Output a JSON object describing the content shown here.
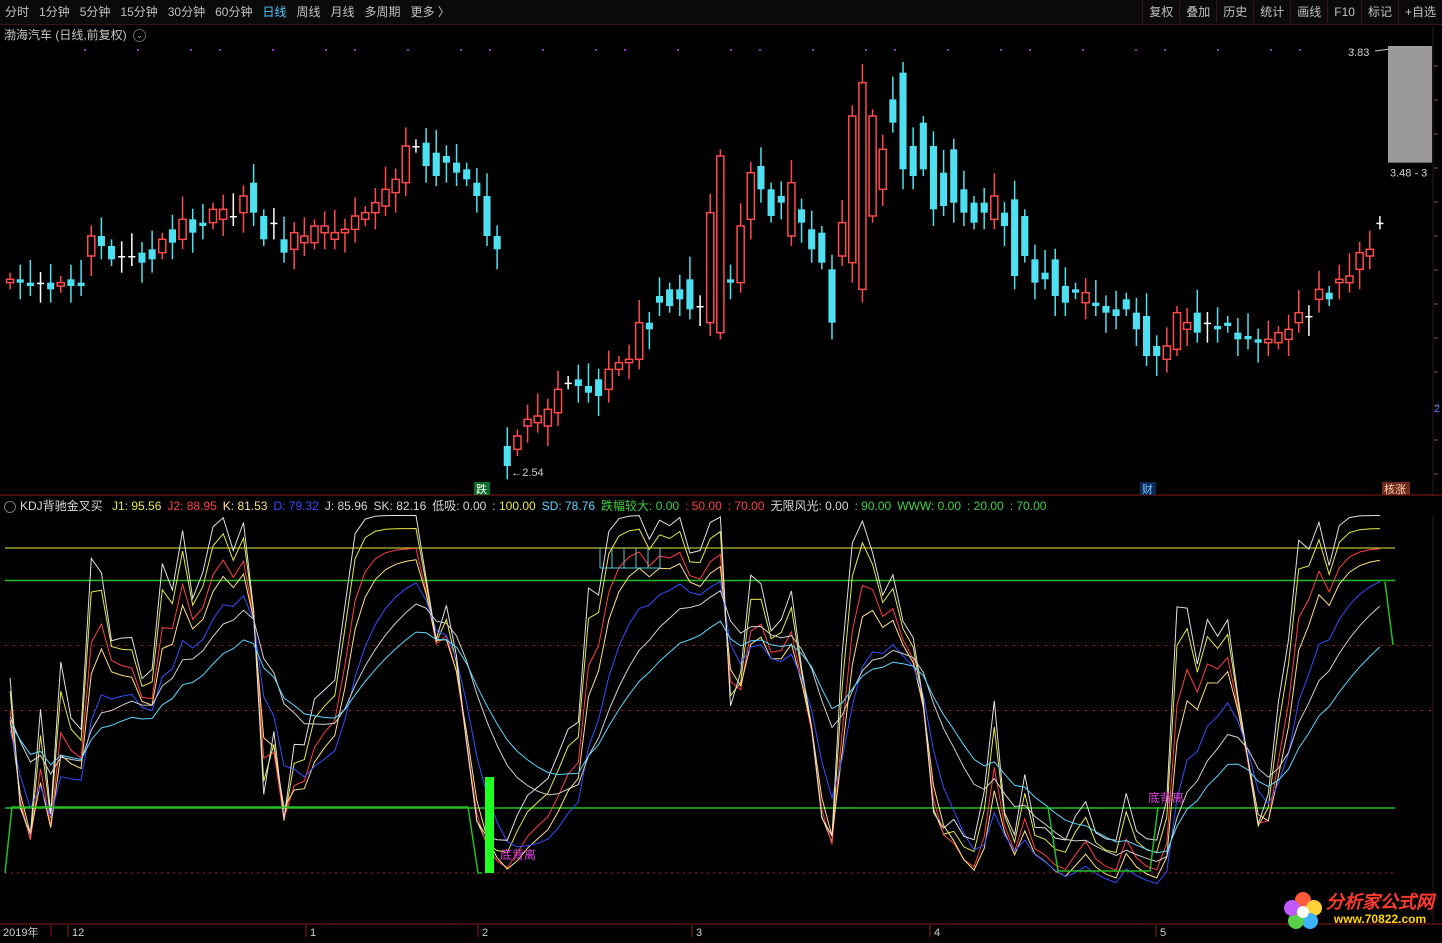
{
  "toolbar": {
    "periods": [
      {
        "label": "分时",
        "active": false
      },
      {
        "label": "1分钟",
        "active": false
      },
      {
        "label": "5分钟",
        "active": false
      },
      {
        "label": "15分钟",
        "active": false
      },
      {
        "label": "30分钟",
        "active": false
      },
      {
        "label": "60分钟",
        "active": false
      },
      {
        "label": "日线",
        "active": true
      },
      {
        "label": "周线",
        "active": false
      },
      {
        "label": "月线",
        "active": false
      },
      {
        "label": "多周期",
        "active": false
      },
      {
        "label": "更多 〉",
        "active": false
      }
    ],
    "tools": [
      "复权",
      "叠加",
      "历史",
      "统计",
      "画线",
      "F10",
      "标记",
      "+自选"
    ]
  },
  "stock": {
    "title": "渤海汽车 (日线,前复权)"
  },
  "price_axis": {
    "high_label": "3.83",
    "last_label": "3.48 - 3",
    "edge_label": "2"
  },
  "price_marks": {
    "low_label": "2.54"
  },
  "event_tags": [
    {
      "text": "跌",
      "color": "#ffffff",
      "bg": "#0f6b2a"
    },
    {
      "text": "财",
      "color": "#7fc8ff",
      "bg": "#0a2a55"
    },
    {
      "text": "核涨",
      "color": "#ffd0b0",
      "bg": "#6b2a1a"
    }
  ],
  "indicator": {
    "name": "KDJ背驰金叉买",
    "items": [
      {
        "text": "J1: 95.56",
        "color": "#e8e84a"
      },
      {
        "text": "J2: 88.95",
        "color": "#ff4040"
      },
      {
        "text": "K: 81.53",
        "color": "#ffe080"
      },
      {
        "text": "D: 79.32",
        "color": "#3050ff"
      },
      {
        "text": "J: 85.96",
        "color": "#d8d8d8"
      },
      {
        "text": "SK: 82.16",
        "color": "#d8d8d8"
      },
      {
        "text": "低吸: 0.00",
        "color": "#d8d8d8"
      },
      {
        "text": ": 100.00",
        "color": "#e8e84a"
      },
      {
        "text": "SD: 78.76",
        "color": "#5ad8ff"
      },
      {
        "text": "跌幅较大: 0.00",
        "color": "#40d040"
      },
      {
        "text": ": 50.00",
        "color": "#ff4040"
      },
      {
        "text": ": 70.00",
        "color": "#ff4040"
      },
      {
        "text": "无限风光: 0.00",
        "color": "#d8d8d8"
      },
      {
        "text": ": 90.00",
        "color": "#40d040"
      },
      {
        "text": "WWW: 0.00",
        "color": "#40d040"
      },
      {
        "text": ": 20.00",
        "color": "#40d040"
      },
      {
        "text": ": 70.00",
        "color": "#40d040"
      }
    ],
    "annotations": [
      "底背离",
      "底背离"
    ]
  },
  "date_axis": [
    "2019年",
    "12",
    "1",
    "2",
    "3",
    "4",
    "5"
  ],
  "watermark": {
    "text": "分析家公式网",
    "url": "www.70822.com"
  },
  "colors": {
    "up": "#ff4a4a",
    "down": "#4ee0f0",
    "flat": "#ffffff"
  },
  "chart_data": {
    "type": "candlestick",
    "open": [
      3.12,
      3.13,
      3.12,
      3.12,
      3.12,
      3.11,
      3.13,
      3.12,
      3.2,
      3.26,
      3.23,
      3.2,
      3.2,
      3.21,
      3.22,
      3.21,
      3.28,
      3.25,
      3.31,
      3.3,
      3.3,
      3.31,
      3.32,
      3.33,
      3.42,
      3.32,
      3.3,
      3.25,
      3.22,
      3.24,
      3.24,
      3.27,
      3.25,
      3.27,
      3.28,
      3.31,
      3.33,
      3.35,
      3.39,
      3.42,
      3.53,
      3.54,
      3.51,
      3.5,
      3.48,
      3.46,
      3.42,
      3.38,
      3.26,
      2.63,
      2.62,
      2.69,
      2.7,
      2.69,
      2.73,
      2.82,
      2.83,
      2.81,
      2.83,
      2.8,
      2.86,
      2.88,
      2.89,
      3.0,
      3.08,
      3.1,
      3.1,
      3.13,
      3.05,
      3.0,
      2.97,
      3.13,
      3.12,
      3.31,
      3.47,
      3.4,
      3.38,
      3.26,
      3.34,
      3.28,
      3.27,
      3.16,
      3.2,
      3.18,
      3.1,
      3.32,
      3.4,
      3.67,
      3.75,
      3.53,
      3.6,
      3.53,
      3.45,
      3.52,
      3.4,
      3.36,
      3.36,
      3.31,
      3.33,
      3.37,
      3.32,
      3.19,
      3.15,
      3.19,
      3.11,
      3.1,
      3.06,
      3.06,
      3.05,
      3.04,
      3.07,
      3.03,
      3.02,
      2.93,
      2.89,
      2.92,
      2.98,
      3.03,
      3.0,
      2.99,
      3.0,
      2.97,
      2.96,
      2.95,
      2.94,
      2.94,
      2.95,
      3.0,
      3.02,
      3.07,
      3.09,
      3.12,
      3.12,
      3.16,
      3.2,
      3.3
    ],
    "close": [
      3.13,
      3.12,
      3.11,
      3.12,
      3.1,
      3.12,
      3.11,
      3.11,
      3.26,
      3.23,
      3.19,
      3.2,
      3.2,
      3.18,
      3.19,
      3.25,
      3.24,
      3.31,
      3.27,
      3.29,
      3.34,
      3.34,
      3.32,
      3.38,
      3.33,
      3.25,
      3.3,
      3.21,
      3.27,
      3.26,
      3.29,
      3.29,
      3.27,
      3.28,
      3.32,
      3.33,
      3.36,
      3.4,
      3.43,
      3.53,
      3.53,
      3.47,
      3.44,
      3.48,
      3.45,
      3.43,
      3.38,
      3.26,
      3.22,
      2.57,
      2.66,
      2.71,
      2.72,
      2.74,
      2.8,
      2.82,
      2.81,
      2.79,
      2.78,
      2.86,
      2.88,
      2.89,
      3.0,
      2.98,
      3.06,
      3.05,
      3.07,
      3.04,
      3.05,
      3.33,
      3.5,
      3.12,
      3.29,
      3.45,
      3.4,
      3.32,
      3.36,
      3.42,
      3.3,
      3.22,
      3.18,
      3.0,
      3.3,
      3.62,
      3.72,
      3.62,
      3.52,
      3.6,
      3.46,
      3.44,
      3.46,
      3.34,
      3.35,
      3.36,
      3.33,
      3.3,
      3.33,
      3.38,
      3.29,
      3.14,
      3.2,
      3.12,
      3.13,
      3.08,
      3.06,
      3.09,
      3.09,
      3.05,
      3.03,
      3.02,
      3.04,
      2.98,
      2.9,
      2.9,
      2.93,
      3.03,
      3.0,
      2.97,
      3.0,
      2.98,
      2.99,
      2.95,
      2.95,
      2.94,
      2.95,
      2.97,
      2.98,
      3.03,
      3.02,
      3.1,
      3.07,
      3.13,
      3.14,
      3.21,
      3.22,
      3.3,
      3.48
    ]
  }
}
